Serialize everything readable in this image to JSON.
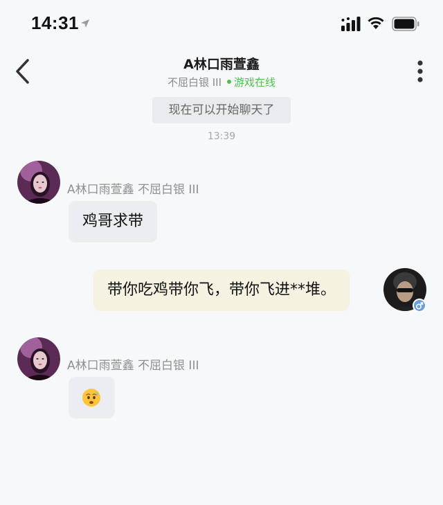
{
  "status_bar": {
    "time": "14:31"
  },
  "header": {
    "title": "A林口雨萱鑫",
    "rank": "不屈白银 III",
    "online_status": "游戏在线",
    "online_color": "#4fbf4f"
  },
  "chat": {
    "system_notice": "现在可以开始聊天了",
    "timestamp": "13:39",
    "messages": [
      {
        "side": "left",
        "sender": "A林口雨萱鑫 不屈白银 III",
        "text": "鸡哥求带"
      },
      {
        "side": "right",
        "text": "带你吃鸡带你飞，带你飞进**堆。",
        "gender": "male"
      },
      {
        "side": "left",
        "sender": "A林口雨萱鑫 不屈白银 III",
        "emoji": "worried-face-emoji"
      }
    ]
  },
  "colors": {
    "background": "#f6f8fa",
    "left_bubble": "#ebedf0",
    "right_bubble": "#f5f2e2",
    "gender_badge": "#6a9ee0"
  }
}
